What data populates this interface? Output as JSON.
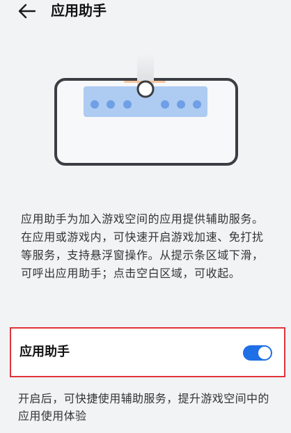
{
  "header": {
    "title": "应用助手",
    "back_icon": "back-arrow-icon"
  },
  "illustration": {
    "icon": "phone-landscape-illustration",
    "accent_color": "#aecbf2"
  },
  "description": "应用助手为加入游戏空间的应用提供辅助服务。在应用或游戏内，可快速开启游戏加速、免打扰等服务，支持悬浮窗操作。从提示条区域下滑，可呼出应用助手；点击空白区域，可收起。",
  "setting": {
    "label": "应用助手",
    "toggle_on": true,
    "toggle_color": "#1f6fe6",
    "highlight_color": "#e0333a"
  },
  "footnote": "开启后，可快捷使用辅助服务，提升游戏空间中的应用使用体验"
}
